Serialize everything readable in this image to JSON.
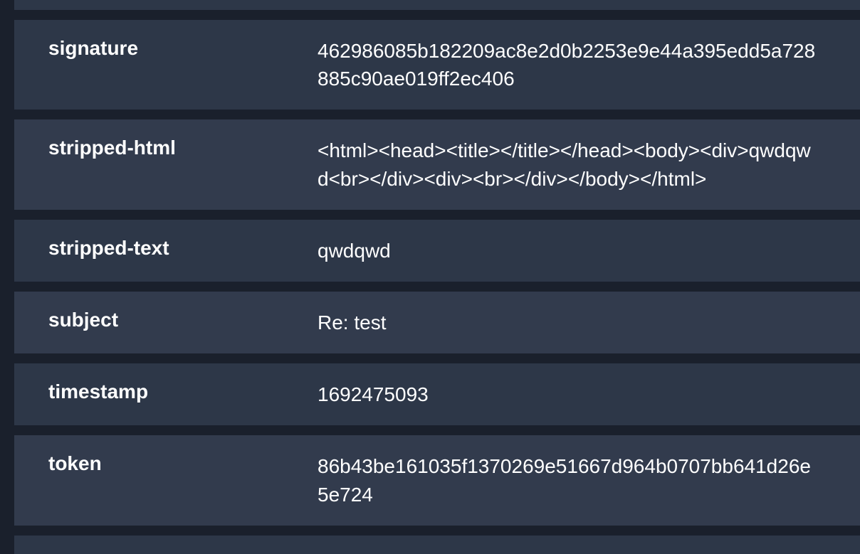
{
  "rows": [
    {
      "key": "signature",
      "value": "462986085b182209ac8e2d0b2253e9e44a395edd5a728885c90ae019ff2ec406"
    },
    {
      "key": "stripped-html",
      "value": "<html><head><title></title></head><body><div>qwdqwd<br></div><div><br></div></body></html>"
    },
    {
      "key": "stripped-text",
      "value": "qwdqwd"
    },
    {
      "key": "subject",
      "value": "Re: test"
    },
    {
      "key": "timestamp",
      "value": "1692475093"
    },
    {
      "key": "token",
      "value": "86b43be161035f1370269e51667d964b0707bb641d26e5e724"
    }
  ]
}
